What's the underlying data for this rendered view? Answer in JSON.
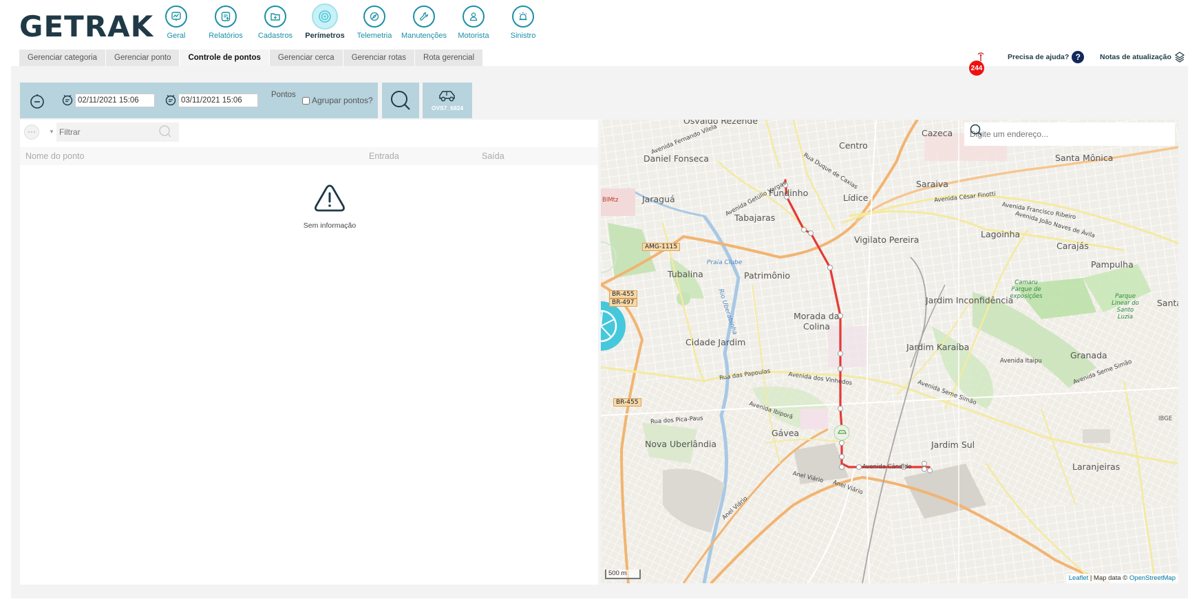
{
  "brand": {
    "logo_text": "GETRAK"
  },
  "nav": {
    "items": [
      {
        "label": "Geral",
        "icon": "chart-line-icon"
      },
      {
        "label": "Relatórios",
        "icon": "report-icon"
      },
      {
        "label": "Cadastros",
        "icon": "folder-plus-icon"
      },
      {
        "label": "Perímetros",
        "icon": "perimeter-target-icon",
        "active": true
      },
      {
        "label": "Telemetria",
        "icon": "compass-icon"
      },
      {
        "label": "Manutenções",
        "icon": "wrench-icon"
      },
      {
        "label": "Motorista",
        "icon": "driver-icon"
      },
      {
        "label": "Sinistro",
        "icon": "alarm-icon"
      }
    ]
  },
  "subtabs": {
    "items": [
      {
        "label": "Gerenciar categoria"
      },
      {
        "label": "Gerenciar ponto"
      },
      {
        "label": "Controle de pontos",
        "active": true
      },
      {
        "label": "Gerenciar cerca"
      },
      {
        "label": "Gerenciar rotas"
      },
      {
        "label": "Rota gerencial"
      }
    ]
  },
  "header_right": {
    "notification_count": "244",
    "help_label": "Precisa de ajuda?",
    "help_glyph": "?",
    "notes_label": "Notas de atualização"
  },
  "toolbar": {
    "date_start": "02/11/2021 15:06",
    "date_end": "03/11/2021 15:06",
    "points_label": "Pontos",
    "group_points_label": "Agrupar pontos?",
    "vehicle_label": "OVS7_6824"
  },
  "filter": {
    "placeholder": "Filtrar"
  },
  "table": {
    "columns": [
      "Nome do ponto",
      "Entrada",
      "Saída"
    ],
    "empty_message": "Sem informação"
  },
  "map": {
    "search_placeholder": "Digite um endereço...",
    "scale_label": "500 m",
    "attribution_leaflet": "Leaflet",
    "attribution_sep": " | Map data © ",
    "attribution_osm": "OpenStreetMap",
    "labels": {
      "osvaldo": "Osvaldo Rezende",
      "centro": "Centro",
      "cazeca": "Cazeca",
      "daniel": "Daniel Fonseca",
      "santamonica": "Santa Mônica",
      "saraiva": "Saraiva",
      "jaragua": "Jaraguá",
      "fundinho": "Fundinho",
      "lidice": "Lídice",
      "tabajaras": "Tabajaras",
      "vigilato": "Vigilato Pereira",
      "lagoinha": "Lagoinha",
      "carajas": "Carajás",
      "pampulha": "Pampulha",
      "tubalina": "Tubalina",
      "patrimonio": "Patrimônio",
      "inconfidencia": "Jardim Inconfidência",
      "santa": "Santa",
      "morada": "Morada da",
      "colina": "Colina",
      "cidadejardim": "Cidade Jardim",
      "karaiba": "Jardim Karaíba",
      "granada": "Granada",
      "gavea": "Gávea",
      "novauber": "Nova Uberlândia",
      "jardimsul": "Jardim Sul",
      "laranjeiras": "Laranjeiras",
      "ibge": "IBGE",
      "amg": "AMG-1115",
      "br455": "BR-455",
      "br497": "BR-497",
      "br455b": "BR-455",
      "bimtz": "BIMtz",
      "praia": "Praia Clube",
      "rio": "Rio Uberabinha",
      "camaru": "Camaru Parque de exposições",
      "parque": "Parque Linear do Santo Luzia",
      "av_getulio": "Avenida Getúlio Vargas",
      "av_papoulas": "Rua das Papoulas",
      "av_vinhedos": "Avenida dos Vinhedos",
      "av_anel": "Anel Viário",
      "av_joao": "Avenida João Naves de Ávila",
      "av_cesar": "Avenida César Finotti",
      "av_francisco": "Avenida Francisco Ribeiro",
      "av_seme": "Avenida Seme Simão",
      "av_itaipu": "Avenida Itaipu",
      "av_ibipora": "Avenida Ibiporã",
      "av_picapaus": "Rua dos Pica-Paus",
      "av_candido": "Avenida Cândido",
      "av_fernando": "Avenida Fernando Vilela",
      "av_duque": "Rua Duque de Caxias"
    }
  },
  "colors": {
    "accent": "#1a8fa6",
    "toolbar_bg": "#b7d3dd",
    "route": "#e53935",
    "badge": "#ee1111"
  }
}
